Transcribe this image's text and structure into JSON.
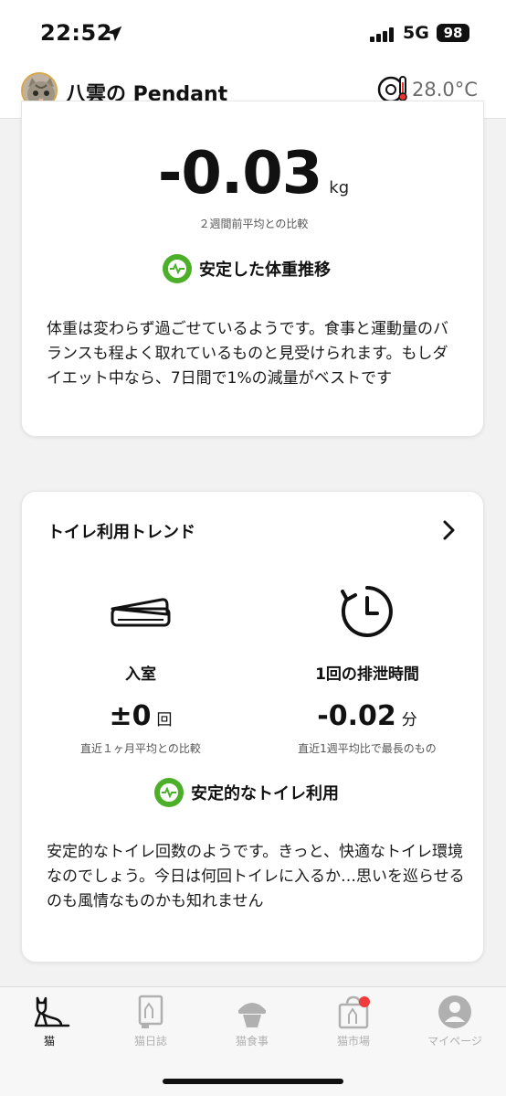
{
  "status_bar": {
    "time": "22:52",
    "network": "5G",
    "battery": "98"
  },
  "header": {
    "device_name": "八雲の Pendant",
    "temperature": "28.0°C"
  },
  "weight_card": {
    "value": "-0.03",
    "unit": "kg",
    "compare_note": "２週間前平均との比較",
    "status": "安定した体重推移",
    "description": "体重は変わらず過ごせているようです。食事と運動量のバランスも程よく取れているものと見受けられます。もしダイエット中なら、7日間で1%の減量がベストです"
  },
  "toilet_card": {
    "title": "トイレ利用トレンド",
    "entry": {
      "label": "入室",
      "value": "±0",
      "unit": "回",
      "note": "直近１ヶ月平均との比較"
    },
    "duration": {
      "label": "1回の排泄時間",
      "value": "-0.02",
      "unit": "分",
      "note": "直近1週平均比で最長のもの"
    },
    "status": "安定的なトイレ利用",
    "description": "安定的なトイレ回数のようです。きっと、快適なトイレ環境なのでしょう。今日は何回トイレに入るか…思いを巡らせるのも風情なものかも知れません"
  },
  "tabs": [
    {
      "label": "猫",
      "icon": "cat-icon",
      "active": true
    },
    {
      "label": "猫日誌",
      "icon": "diary-icon"
    },
    {
      "label": "猫食事",
      "icon": "food-bowl-icon"
    },
    {
      "label": "猫市場",
      "icon": "shopping-bag-icon",
      "badge": true
    },
    {
      "label": "マイページ",
      "icon": "user-icon"
    }
  ],
  "colors": {
    "accent_green": "#4caf2a",
    "badge_red": "#ee3b3b",
    "muted_gray": "#b0b0b0"
  }
}
